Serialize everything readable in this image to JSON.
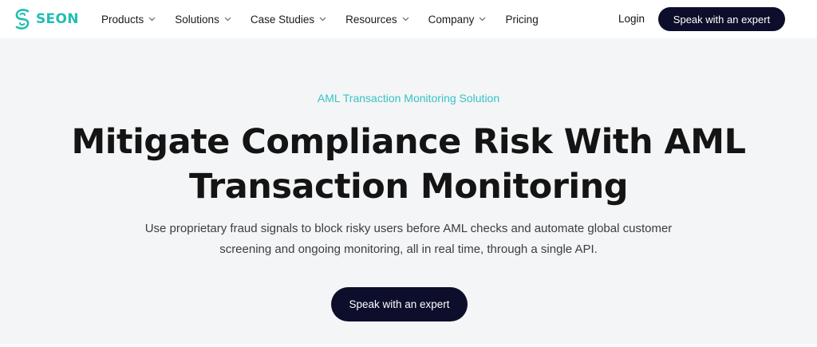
{
  "brand": {
    "name": "SEON",
    "color": "#1fbfb2"
  },
  "nav": {
    "items": [
      {
        "label": "Products",
        "has_dropdown": true
      },
      {
        "label": "Solutions",
        "has_dropdown": true
      },
      {
        "label": "Case Studies",
        "has_dropdown": true
      },
      {
        "label": "Resources",
        "has_dropdown": true
      },
      {
        "label": "Company",
        "has_dropdown": true
      },
      {
        "label": "Pricing",
        "has_dropdown": false
      }
    ],
    "login_label": "Login",
    "cta_label": "Speak with an expert"
  },
  "hero": {
    "eyebrow": "AML Transaction Monitoring Solution",
    "headline_line1": "Mitigate Compliance Risk With AML",
    "headline_line2": "Transaction Monitoring",
    "subtext_line1": "Use proprietary fraud signals to block risky users before AML checks and automate global customer",
    "subtext_line2": "screening and ongoing monitoring, all in real time, through a single API.",
    "cta_label": "Speak with an expert"
  },
  "colors": {
    "accent": "#36c3c6",
    "button_bg": "#0d0e2b",
    "page_bg": "#f4f5f6"
  }
}
